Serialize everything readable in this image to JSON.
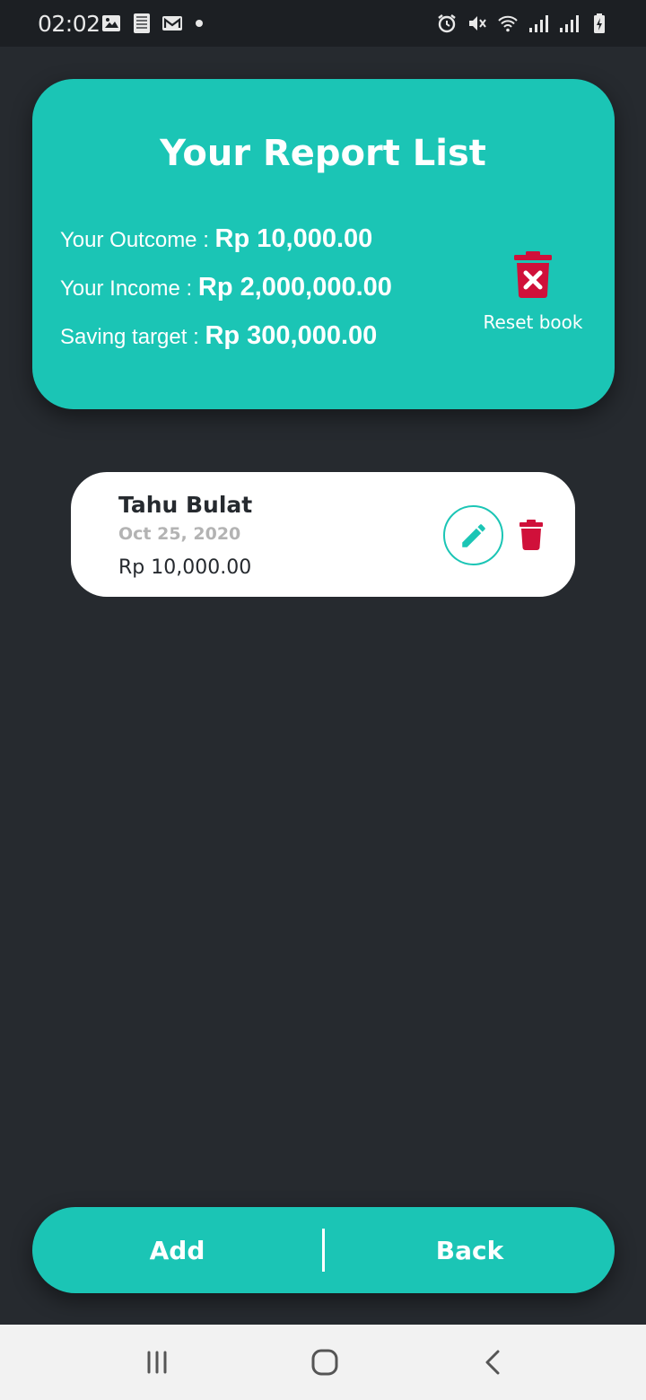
{
  "status_bar": {
    "time": "02:02",
    "left_icons": [
      "image-icon",
      "sim-card-icon",
      "gmail-icon",
      "notification-dot-icon"
    ],
    "right_icons": [
      "alarm-icon",
      "mute-icon",
      "wifi-icon",
      "signal-icon",
      "signal-icon",
      "battery-charging-icon"
    ]
  },
  "report": {
    "title": "Your Report List",
    "outcome_label": "Your Outcome : ",
    "outcome_value": "Rp 10,000.00",
    "income_label": "Your Income : ",
    "income_value": "Rp 2,000,000.00",
    "saving_label": "Saving target : ",
    "saving_value": "Rp 300,000.00",
    "reset_label": "Reset book",
    "reset_icon": "trash-x-icon"
  },
  "items": [
    {
      "name": "Tahu Bulat",
      "date": "Oct 25, 2020",
      "amount": "Rp 10,000.00",
      "edit_icon": "pencil-icon",
      "delete_icon": "trash-icon"
    }
  ],
  "actions": {
    "add_label": "Add",
    "back_label": "Back"
  },
  "nav": {
    "icons": [
      "recent-apps-icon",
      "home-icon",
      "back-icon"
    ]
  },
  "colors": {
    "accent": "#1bc5b5",
    "background": "#262a2f",
    "danger": "#d0103a",
    "card": "#ffffff"
  }
}
